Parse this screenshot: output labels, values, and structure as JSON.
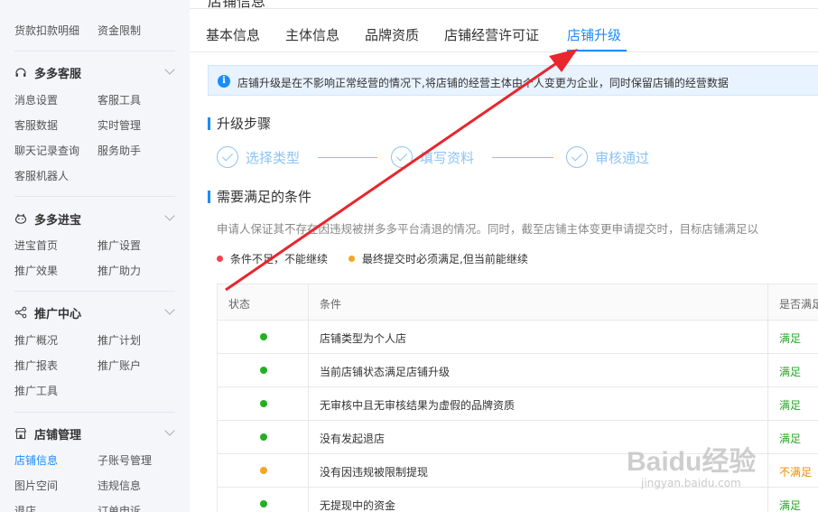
{
  "sidebar": {
    "top_clip": [
      "",
      ""
    ],
    "row_top": [
      "货款扣款明细",
      "资金限制"
    ],
    "sections": [
      {
        "title": "多多客服",
        "icon": "headset-icon",
        "rows": [
          [
            "消息设置",
            "客服工具"
          ],
          [
            "客服数据",
            "实时管理"
          ],
          [
            "聊天记录查询",
            "服务助手"
          ],
          [
            "客服机器人",
            ""
          ]
        ]
      },
      {
        "title": "多多进宝",
        "icon": "piggy-icon",
        "rows": [
          [
            "进宝首页",
            "推广设置"
          ],
          [
            "推广效果",
            "推广助力"
          ]
        ]
      },
      {
        "title": "推广中心",
        "icon": "share-icon",
        "rows": [
          [
            "推广概况",
            "推广计划"
          ],
          [
            "推广报表",
            "推广账户"
          ],
          [
            "推广工具",
            ""
          ]
        ]
      },
      {
        "title": "店铺管理",
        "icon": "store-icon",
        "rows": [
          [
            "店铺信息",
            "子账号管理"
          ],
          [
            "图片空间",
            "违规信息"
          ],
          [
            "退店",
            "订单申诉"
          ]
        ]
      }
    ]
  },
  "main": {
    "page_title": "店铺信息",
    "tabs": [
      "基本信息",
      "主体信息",
      "品牌资质",
      "店铺经营许可证",
      "店铺升级"
    ],
    "active_tab": "店铺升级",
    "notice": "店铺升级是在不影响正常经营的情况下,将店铺的经营主体由个人变更为企业，同时保留店铺的经营数据",
    "steps_title": "升级步骤",
    "steps": [
      "选择类型",
      "填写资料",
      "审核通过"
    ],
    "conditions_title": "需要满足的条件",
    "description": "申请人保证其不存在因违规被拼多多平台清退的情况。同时，截至店铺主体变更申请提交时，目标店铺满足以",
    "legend": [
      {
        "label": "条件不足，不能继续",
        "color": "#f0434f"
      },
      {
        "label": "最终提交时必须满足,但当前能继续",
        "color": "#f5a623"
      }
    ],
    "table": {
      "headers": [
        "状态",
        "条件",
        "是否满足"
      ],
      "rows": [
        {
          "status_color": "#22b022",
          "condition": "店铺类型为个人店",
          "result": "满足"
        },
        {
          "status_color": "#22b022",
          "condition": "当前店铺状态满足店铺升级",
          "result": "满足"
        },
        {
          "status_color": "#22b022",
          "condition": "无审核中且无审核结果为虚假的品牌资质",
          "result": "满足"
        },
        {
          "status_color": "#22b022",
          "condition": "没有发起退店",
          "result": "满足"
        },
        {
          "status_color": "#f5a623",
          "condition": "没有因违规被限制提现",
          "result": "不满足"
        },
        {
          "status_color": "#22b022",
          "condition": "无提现中的资金",
          "result": "满足"
        }
      ]
    }
  },
  "watermark": {
    "line1": "Baidu经验",
    "line2": "jingyan.baidu.com"
  }
}
